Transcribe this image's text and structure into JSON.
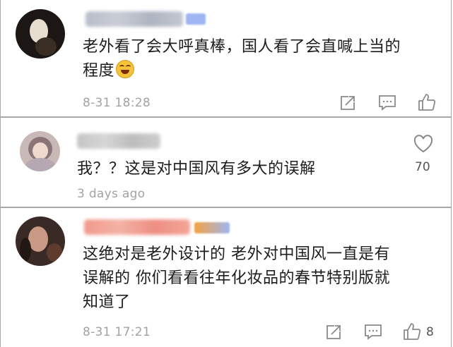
{
  "comments": [
    {
      "text_lines": [
        "老外看了会大呼真棒，国人看了会直喊上当的",
        "程度"
      ],
      "emoji": "laughing-crying-emoji",
      "timestamp": "8-31 18:28",
      "likes": ""
    },
    {
      "text_lines": [
        "我？？这是对中国风有多大的误解"
      ],
      "timestamp": "3 days ago",
      "likes": "70"
    },
    {
      "text_lines": [
        "这绝对是老外设计的 老外对中国风一直是有",
        "误解的 你们看看往年化妆品的春节特别版就",
        "知道了"
      ],
      "timestamp": "8-31 17:21",
      "likes": "8"
    }
  ],
  "colors": {
    "text": "#1c1c1c",
    "timestamp": "#a3a3a3",
    "icon": "#8a8a8a",
    "divider": "#a8a8a8"
  },
  "icons": [
    "share-icon",
    "reply-icon",
    "like-icon",
    "heart-icon"
  ]
}
